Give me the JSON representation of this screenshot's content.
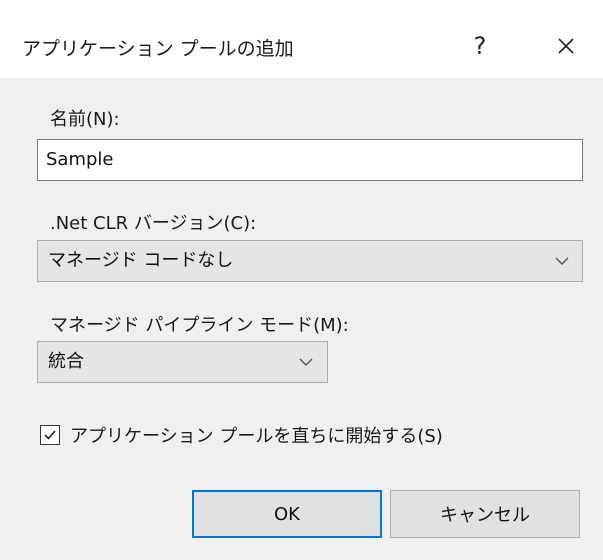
{
  "dialog": {
    "title": "アプリケーション プールの追加",
    "help_label": "?"
  },
  "form": {
    "name_label": "名前(N):",
    "name_value": "Sample",
    "clr_label": ".Net CLR バージョン(C):",
    "clr_selected": "マネージド コードなし",
    "pipeline_label": "マネージド パイプライン モード(M):",
    "pipeline_selected": "統合",
    "start_immediately_label": "アプリケーション プールを直ちに開始する(S)",
    "start_immediately_checked": true
  },
  "buttons": {
    "ok_label": "OK",
    "cancel_label": "キャンセル"
  },
  "icons": {
    "close": "close-icon",
    "chevron": "chevron-down-icon",
    "check": "checkmark-icon"
  },
  "colors": {
    "dialog_bg": "#f0f0f0",
    "default_button_border": "#0078d7"
  }
}
